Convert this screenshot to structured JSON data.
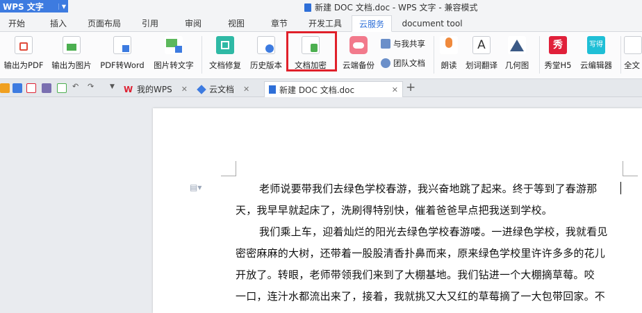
{
  "app": {
    "name": "WPS 文字",
    "window_title": "新建 DOC 文档.doc - WPS 文字 - 兼容模式"
  },
  "menu_tabs": [
    "开始",
    "插入",
    "页面布局",
    "引用",
    "审阅",
    "视图",
    "章节",
    "开发工具",
    "云服务",
    "document tool"
  ],
  "active_menu_tab": "云服务",
  "ribbon": {
    "buttons": [
      "输出为PDF",
      "输出为图片",
      "PDF转Word",
      "图片转文字",
      "文档修复",
      "历史版本",
      "文档加密",
      "云端备份",
      "朗读",
      "划词翻译",
      "几何图",
      "秀堂H5",
      "云编辑器",
      "全文"
    ],
    "small_buttons": [
      "与我共享",
      "团队文档"
    ],
    "highlighted": "文档加密",
    "icon_texts": {
      "xiu": "秀",
      "xiexie": "写得",
      "ai": "A"
    }
  },
  "doc_tabs": [
    {
      "label": "我的WPS"
    },
    {
      "label": "云文档"
    },
    {
      "label": "新建 DOC 文档.doc"
    }
  ],
  "document": {
    "lines": [
      "老师说要带我们去绿色学校春游，我兴奋地跳了起来。终于等到了春游那",
      "天，我早早就起床了，洗刷得特别快，催着爸爸早点把我送到学校。",
      "我们乘上车，迎着灿烂的阳光去绿色学校春游喽。一进绿色学校，我就看见",
      "密密麻麻的大树，还带着一股股清香扑鼻而来，原来绿色学校里许许多多的花儿",
      "开放了。转眼，老师带领我们来到了大棚基地。我们钻进一个大棚摘草莓。咬",
      "一口，连汁水都流出来了，接着，我就挑又大又红的草莓摘了一大包带回家。不"
    ]
  },
  "colors": {
    "accent": "#2e6fd8",
    "highlight_box": "#e0202a",
    "app_button": "#3d7be0"
  }
}
